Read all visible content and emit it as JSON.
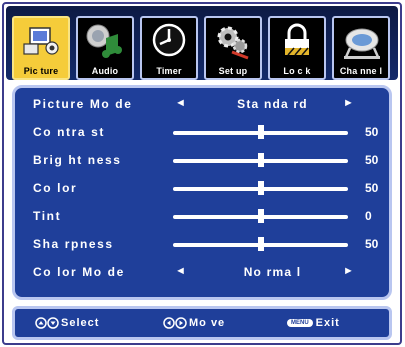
{
  "tabs": [
    {
      "label": "Pic ture",
      "icon": "picture-icon",
      "active": true
    },
    {
      "label": "Audio",
      "icon": "audio-icon",
      "active": false
    },
    {
      "label": "Timer",
      "icon": "timer-icon",
      "active": false
    },
    {
      "label": "Set up",
      "icon": "setup-icon",
      "active": false
    },
    {
      "label": "Lo c k",
      "icon": "lock-icon",
      "active": false
    },
    {
      "label": "Cha nne l",
      "icon": "channel-icon",
      "active": false
    }
  ],
  "settings": [
    {
      "name": "Picture Mo de",
      "type": "option",
      "value": "Sta nda rd"
    },
    {
      "name": "Co ntra st",
      "type": "slider",
      "value": "50",
      "level": 0.5
    },
    {
      "name": "Brig ht ness",
      "type": "slider",
      "value": "50",
      "level": 0.5
    },
    {
      "name": "Co lor",
      "type": "slider",
      "value": "50",
      "level": 0.5
    },
    {
      "name": "Tint",
      "type": "slider",
      "value": "0",
      "level": 0.5
    },
    {
      "name": "Sha rpness",
      "type": "slider",
      "value": "50",
      "level": 0.5
    },
    {
      "name": "Co lor Mo de",
      "type": "option",
      "value": "No rma l"
    }
  ],
  "arrows": {
    "left": "◄",
    "right": "►"
  },
  "footer": {
    "select_label": "Select",
    "move_label": "Mo ve",
    "menu_badge": "MENU",
    "exit_label": "Exit"
  },
  "colors": {
    "panel": "#1f3f9a",
    "panel_border": "#b9c6f0",
    "active_tab": "#f5cc3a",
    "tab_bar": "#0d1a44"
  }
}
